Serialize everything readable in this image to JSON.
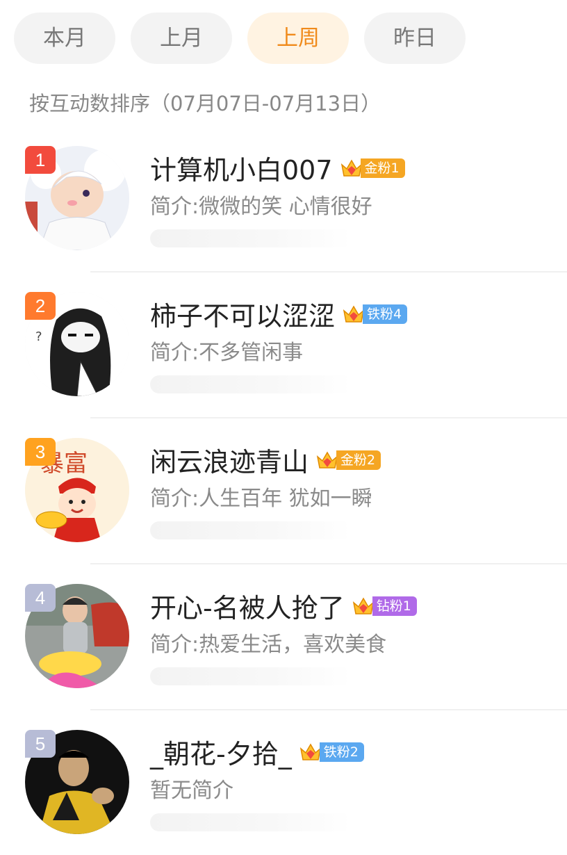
{
  "tabs": [
    {
      "label": "本月",
      "active": false
    },
    {
      "label": "上月",
      "active": false
    },
    {
      "label": "上周",
      "active": true
    },
    {
      "label": "昨日",
      "active": false
    }
  ],
  "sort_note": "按互动数排序（07月07日-07月13日）",
  "colors": {
    "accent": "#f08a1b",
    "rank_1": "#f24b3d",
    "rank_2": "#ff7a2e",
    "rank_3": "#ffa21f",
    "rank_other": "#b7bcd6",
    "badge_gold": "#f5a623",
    "badge_iron": "#5ba8f0",
    "badge_diamond": "#b06ae8"
  },
  "users": [
    {
      "rank": "1",
      "name": "计算机小白007",
      "crown_icon": "crown-icon",
      "badge": "金粉1",
      "badge_type": "gold",
      "bio": "简介:微微的笑 心情很好",
      "avatar": "anime-avatar"
    },
    {
      "rank": "2",
      "name": "柿子不可以涩涩",
      "crown_icon": "crown-icon",
      "badge": "铁粉4",
      "badge_type": "iron",
      "bio": "简介:不多管闲事",
      "avatar": "sketch-girl-avatar"
    },
    {
      "rank": "3",
      "name": "闲云浪迹青山",
      "crown_icon": "crown-icon",
      "badge": "金粉2",
      "badge_type": "gold",
      "bio": "简介:人生百年 犹如一瞬",
      "avatar": "caishen-avatar",
      "avatar_text": "暴富"
    },
    {
      "rank": "4",
      "name": "开心-名被人抢了",
      "crown_icon": "crown-icon",
      "badge": "钻粉1",
      "badge_type": "diamond",
      "bio": "简介:热爱生活，喜欢美食",
      "avatar": "child-photo-avatar"
    },
    {
      "rank": "5",
      "name": "_朝花-夕拾_",
      "crown_icon": "crown-icon",
      "badge": "铁粉2",
      "badge_type": "iron",
      "bio": "暂无简介",
      "avatar": "martial-artist-avatar"
    }
  ]
}
